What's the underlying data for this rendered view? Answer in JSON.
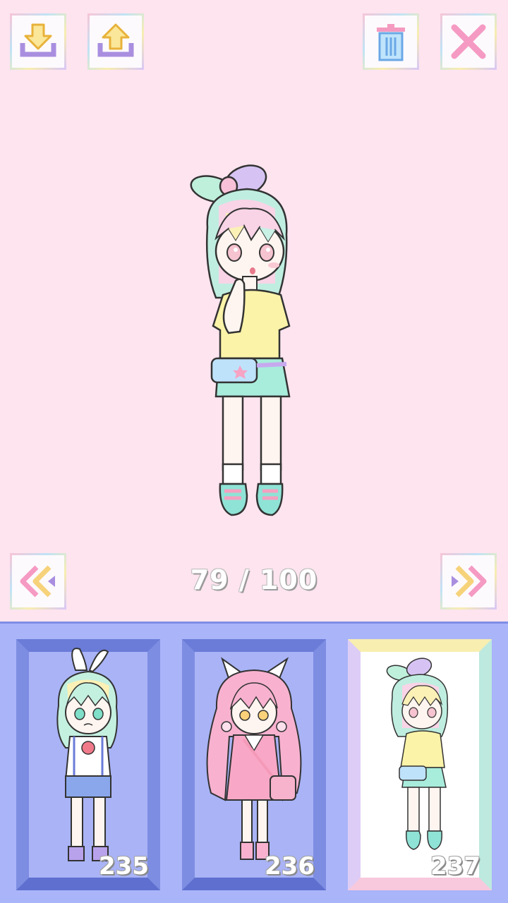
{
  "toolbar": {
    "download_icon": "download-tray-icon",
    "upload_icon": "upload-tray-icon",
    "delete_icon": "trash-can-icon",
    "close_icon": "close-x-icon"
  },
  "navigation": {
    "prev_icon": "double-chevron-left-icon",
    "next_icon": "double-chevron-right-icon"
  },
  "counter": {
    "current": "79",
    "separator": "/",
    "total": "100"
  },
  "slots": [
    {
      "number": "235",
      "selected": false
    },
    {
      "number": "236",
      "selected": false
    },
    {
      "number": "237",
      "selected": true
    }
  ],
  "colors": {
    "background": "#fde4ef",
    "panel": "#aab4f8",
    "slot_frame": "#6a7bd8",
    "selected_frame_top": "#f8eeb0",
    "selected_frame_bottom": "#f8c9dc"
  }
}
